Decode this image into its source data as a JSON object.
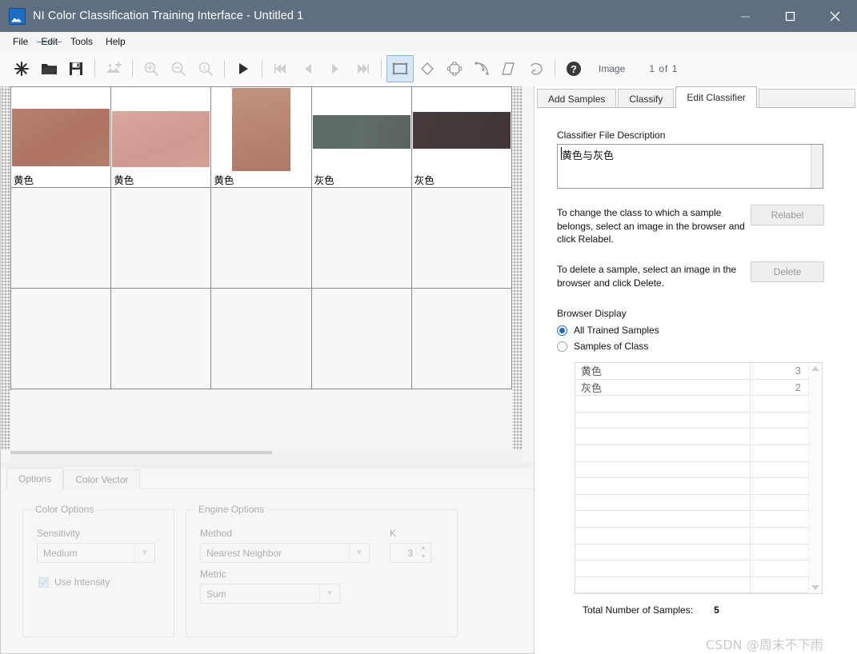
{
  "window": {
    "title": "NI Color Classification Training Interface - Untitled 1",
    "icon": "image-app-icon",
    "titlebar_color": "#5f6f82",
    "controls": [
      {
        "name": "minimize-button",
        "glyph": "minimize"
      },
      {
        "name": "maximize-button",
        "glyph": "maximize"
      },
      {
        "name": "close-button",
        "glyph": "close"
      }
    ]
  },
  "menubar": {
    "items": [
      {
        "label": "File",
        "struck": false
      },
      {
        "label": "Edit",
        "struck": true
      },
      {
        "label": "Tools",
        "struck": false
      },
      {
        "label": "Help",
        "struck": false
      }
    ]
  },
  "toolbar": {
    "buttons": [
      {
        "name": "new-icon",
        "enabled": true
      },
      {
        "name": "open-folder-icon",
        "enabled": true
      },
      {
        "name": "save-floppy-icon",
        "enabled": true
      },
      {
        "name": "add-image-icon",
        "enabled": false
      },
      {
        "name": "zoom-in-icon",
        "enabled": false
      },
      {
        "name": "zoom-out-icon",
        "enabled": false
      },
      {
        "name": "zoom-one-to-one-icon",
        "enabled": false
      },
      {
        "name": "play-icon",
        "enabled": true
      },
      {
        "name": "first-image-icon",
        "enabled": false
      },
      {
        "name": "previous-image-icon",
        "enabled": false
      },
      {
        "name": "next-image-icon",
        "enabled": false
      },
      {
        "name": "last-image-icon",
        "enabled": false
      },
      {
        "name": "rectangle-roi-icon",
        "enabled": true,
        "selected": true
      },
      {
        "name": "rotated-rectangle-roi-icon",
        "enabled": true
      },
      {
        "name": "oval-roi-icon",
        "enabled": true
      },
      {
        "name": "annulus-roi-icon",
        "enabled": true
      },
      {
        "name": "parallelogram-roi-icon",
        "enabled": true
      },
      {
        "name": "freehand-roi-icon",
        "enabled": true
      },
      {
        "name": "help-icon",
        "enabled": true
      }
    ],
    "image_label": "Image",
    "image_counter": "1 of 1"
  },
  "browser": {
    "columns": 5,
    "rows": 3,
    "samples": [
      {
        "label": "黄色",
        "color": "#b57a6a",
        "orientation": "landscape"
      },
      {
        "label": "黄色",
        "color": "#d3a096",
        "orientation": "landscape"
      },
      {
        "label": "黄色",
        "color": "#b98a72",
        "orientation": "portrait"
      },
      {
        "label": "灰色",
        "color": "#5a6660",
        "orientation": "band"
      },
      {
        "label": "灰色",
        "color": "#44393a",
        "orientation": "band"
      }
    ]
  },
  "options_panel": {
    "tabs": [
      {
        "label": "Options",
        "active": true
      },
      {
        "label": "Color Vector",
        "active": false
      }
    ],
    "color_options": {
      "group_title": "Color Options",
      "sensitivity_label": "Sensitivity",
      "sensitivity_value": "Medium",
      "use_intensity_label": "Use Intensity",
      "use_intensity_checked": true
    },
    "engine_options": {
      "group_title": "Engine Options",
      "method_label": "Method",
      "method_value": "Nearest Neighbor",
      "k_label": "K",
      "k_value": "3",
      "metric_label": "Metric",
      "metric_value": "Sum"
    }
  },
  "right_panel": {
    "tabs": [
      {
        "label": "Add Samples",
        "active": false
      },
      {
        "label": "Classify",
        "active": false
      },
      {
        "label": "Edit Classifier",
        "active": true
      }
    ],
    "description_label": "Classifier File Description",
    "description_value": "黄色与灰色",
    "relabel_help": "To change the class to which a sample belongs, select an image in the browser and click Relabel.",
    "relabel_button": "Relabel",
    "delete_help": "To delete a sample, select an image in the browser and click Delete.",
    "delete_button": "Delete",
    "browser_display_label": "Browser Display",
    "radio_all_trained": "All Trained Samples",
    "radio_samples_of_class": "Samples of Class",
    "radio_selected": "All Trained Samples",
    "class_table": {
      "rows": [
        {
          "name": "黄色",
          "count": "3"
        },
        {
          "name": "灰色",
          "count": "2"
        },
        {
          "name": "",
          "count": ""
        },
        {
          "name": "",
          "count": ""
        },
        {
          "name": "",
          "count": ""
        },
        {
          "name": "",
          "count": ""
        },
        {
          "name": "",
          "count": ""
        },
        {
          "name": "",
          "count": ""
        },
        {
          "name": "",
          "count": ""
        },
        {
          "name": "",
          "count": ""
        },
        {
          "name": "",
          "count": ""
        },
        {
          "name": "",
          "count": ""
        },
        {
          "name": "",
          "count": ""
        },
        {
          "name": "",
          "count": ""
        }
      ]
    },
    "total_label": "Total Number of Samples:",
    "total_value": "5"
  },
  "watermark": "CSDN @周末不下雨"
}
